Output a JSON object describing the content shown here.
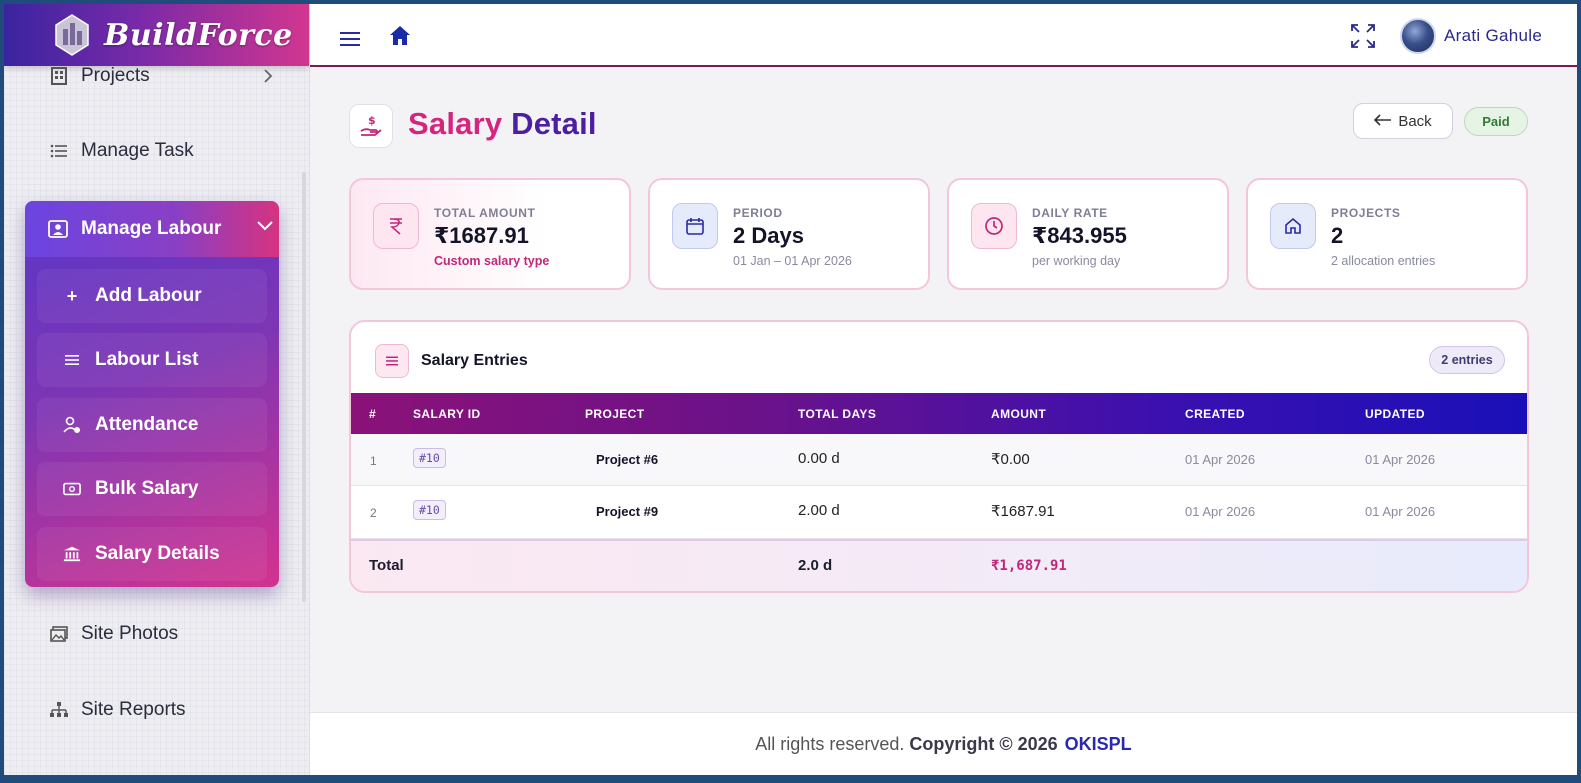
{
  "brand": {
    "name": "BuildForce"
  },
  "sidebar": {
    "projects_label": "Projects",
    "manage_task_label": "Manage Task",
    "manage_labour_label": "Manage Labour",
    "sub_items": [
      "Add Labour",
      "Labour List",
      "Attendance",
      "Bulk Salary",
      "Salary Details"
    ],
    "site_photos_label": "Site Photos",
    "site_reports_label": "Site Reports"
  },
  "header": {
    "user_name": "Arati Gahule"
  },
  "page": {
    "title_part1": "Salary",
    "title_part2": "Detail",
    "back_label": "Back",
    "status": "Paid"
  },
  "stats": [
    {
      "label": "TOTAL AMOUNT",
      "value": "₹1687.91",
      "sub": "Custom salary type"
    },
    {
      "label": "PERIOD",
      "value": "2 Days",
      "sub": "01 Jan – 01 Apr 2026"
    },
    {
      "label": "DAILY RATE",
      "value": "₹843.955",
      "sub": "per working day"
    },
    {
      "label": "PROJECTS",
      "value": "2",
      "sub": "2 allocation entries"
    }
  ],
  "entries": {
    "title": "Salary Entries",
    "count_badge": "2 entries",
    "columns": [
      "#",
      "SALARY ID",
      "PROJECT",
      "TOTAL DAYS",
      "AMOUNT",
      "CREATED",
      "UPDATED"
    ],
    "rows": [
      {
        "num": "1",
        "salary_id": "#10",
        "project": "Project #6",
        "total_days": "0.00 d",
        "amount": "₹0.00",
        "created": "01 Apr 2026",
        "updated": "01 Apr 2026"
      },
      {
        "num": "2",
        "salary_id": "#10",
        "project": "Project #9",
        "total_days": "2.00 d",
        "amount": "₹1687.91",
        "created": "01 Apr 2026",
        "updated": "01 Apr 2026"
      }
    ],
    "total": {
      "label": "Total",
      "days": "2.0 d",
      "amount": "₹1,687.91"
    }
  },
  "footer": {
    "text": "All rights reserved.",
    "copyright": "Copyright © 2026",
    "company": "OKISPL"
  },
  "colors": {
    "pink": "#d4267e",
    "purple": "#4b1fa0",
    "navy": "#2a2ab0"
  }
}
